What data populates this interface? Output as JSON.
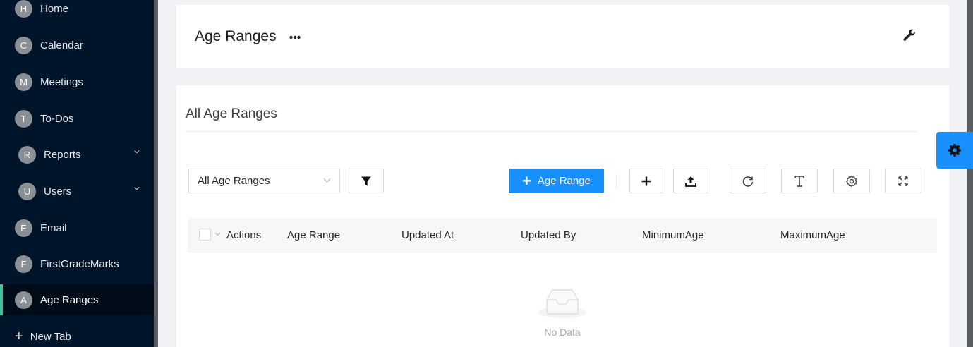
{
  "sidebar": {
    "items": [
      {
        "initial": "H",
        "label": "Home"
      },
      {
        "initial": "C",
        "label": "Calendar"
      },
      {
        "initial": "M",
        "label": "Meetings"
      },
      {
        "initial": "T",
        "label": "To-Dos"
      },
      {
        "initial": "R",
        "label": "Reports",
        "has_submenu": true
      },
      {
        "initial": "U",
        "label": "Users",
        "has_submenu": true
      },
      {
        "initial": "E",
        "label": "Email"
      },
      {
        "initial": "F",
        "label": "FirstGradeMarks"
      },
      {
        "initial": "A",
        "label": "Age Ranges",
        "active": true
      }
    ],
    "new_tab_label": "New Tab"
  },
  "header": {
    "title": "Age Ranges",
    "more_icon": "ellipsis-icon",
    "settings_icon": "wrench-icon"
  },
  "main": {
    "card_title": "All Age Ranges",
    "toolbar": {
      "view_select_value": "All Age Ranges",
      "add_button_label": "Age Range",
      "icons": [
        "filter-icon",
        "plus-icon",
        "upload-icon",
        "reload-icon",
        "text-height-icon",
        "settings-icon",
        "fullscreen-icon"
      ]
    },
    "table": {
      "columns": [
        "Actions",
        "Age Range",
        "Updated At",
        "Updated By",
        "MinimumAge",
        "MaximumAge"
      ],
      "rows": [],
      "empty_text": "No Data"
    }
  },
  "colors": {
    "sidebar_bg": "#001529",
    "accent": "#1890ff",
    "active_indicator": "#3dbf9a",
    "page_bg": "#f0f2f5"
  }
}
